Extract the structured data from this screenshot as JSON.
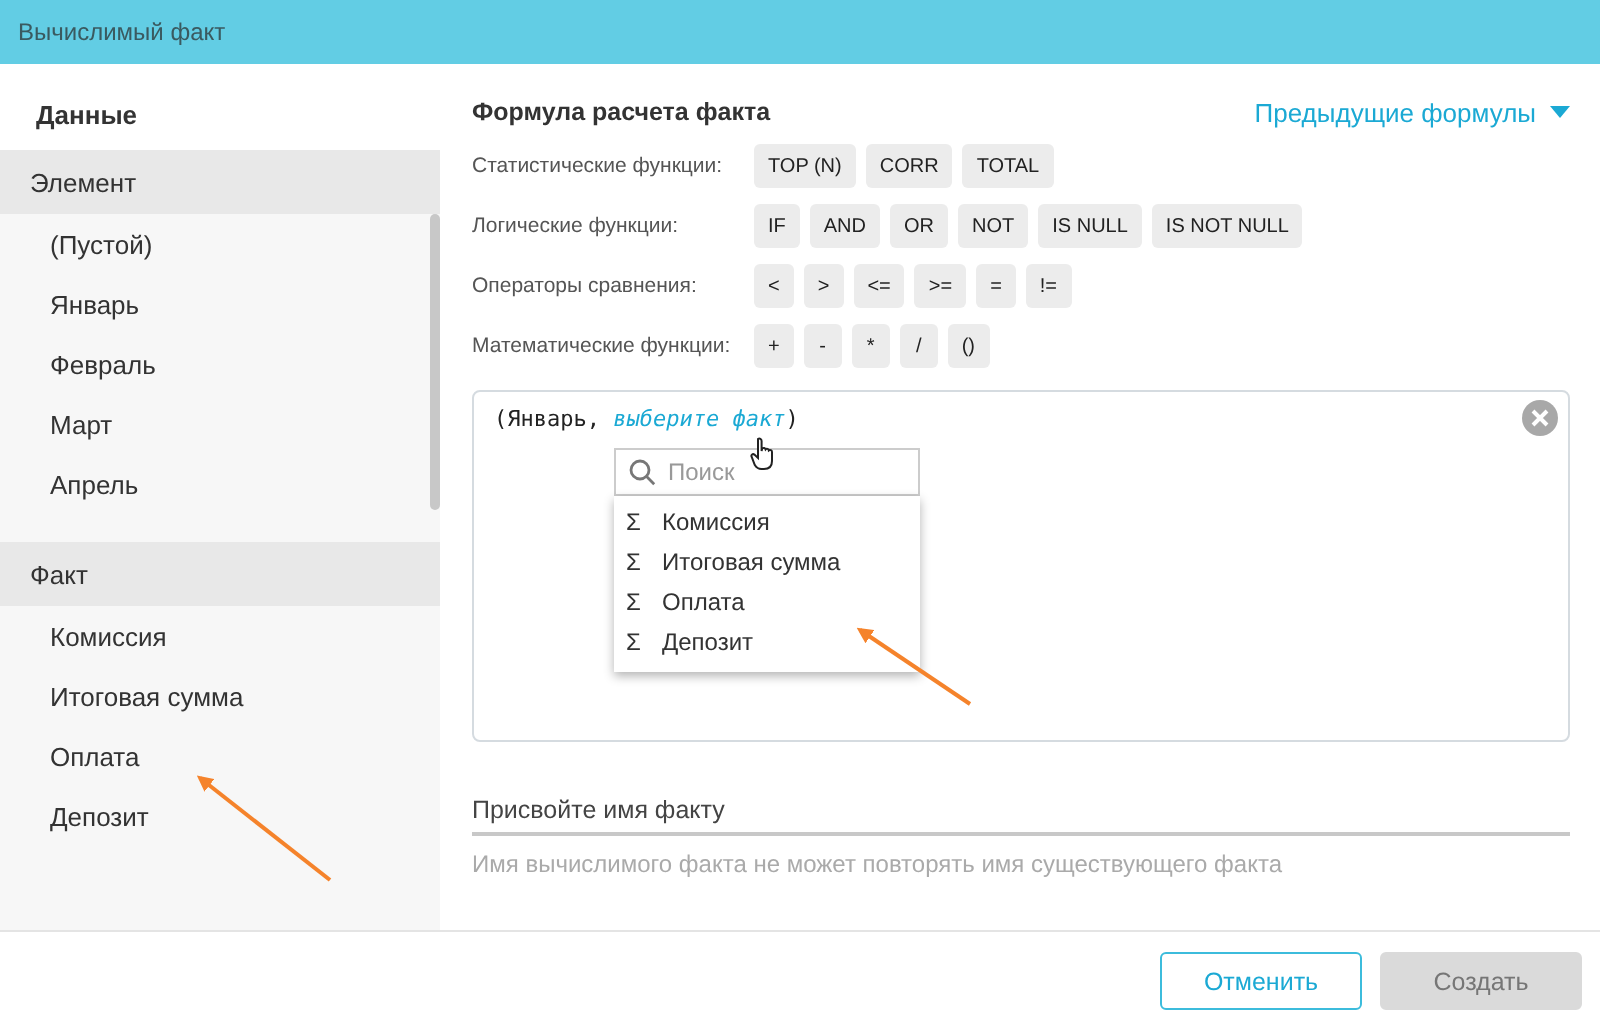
{
  "window": {
    "title": "Вычислимый факт"
  },
  "sidebar": {
    "title": "Данные",
    "sections": [
      {
        "title": "Элемент",
        "items": [
          "(Пустой)",
          "Январь",
          "Февраль",
          "Март",
          "Апрель"
        ]
      },
      {
        "title": "Факт",
        "items": [
          "Комиссия",
          "Итоговая сумма",
          "Оплата",
          "Депозит"
        ]
      }
    ]
  },
  "formula": {
    "title": "Формула расчета факта",
    "history_link": "Предыдущие формулы",
    "groups": [
      {
        "label": "Статистические функции:",
        "buttons": [
          "TOP (N)",
          "CORR",
          "TOTAL"
        ]
      },
      {
        "label": "Логические функции:",
        "buttons": [
          "IF",
          "AND",
          "OR",
          "NOT",
          "IS NULL",
          "IS NOT NULL"
        ]
      },
      {
        "label": "Операторы сравнения:",
        "buttons": [
          "<",
          ">",
          "<=",
          ">=",
          "=",
          "!="
        ]
      },
      {
        "label": "Математические функции:",
        "buttons": [
          "+",
          "-",
          "*",
          "/",
          "()"
        ]
      }
    ],
    "editor": {
      "prefix": "(Январь, ",
      "link": "выберите факт",
      "suffix": ")"
    },
    "dropdown": {
      "placeholder": "Поиск",
      "items": [
        {
          "symbol": "Σ",
          "label": "Комиссия"
        },
        {
          "symbol": "Σ",
          "label": "Итоговая сумма"
        },
        {
          "symbol": "Σ",
          "label": "Оплата"
        },
        {
          "symbol": "Σ",
          "label": "Депозит"
        }
      ]
    }
  },
  "name_field": {
    "placeholder": "Присвойте имя факту",
    "hint": "Имя вычислимого факта не может повторять имя существующего факта"
  },
  "buttons": [
    {
      "label": "Отменить",
      "disabled": false
    },
    {
      "label": "Создать",
      "disabled": true
    }
  ]
}
